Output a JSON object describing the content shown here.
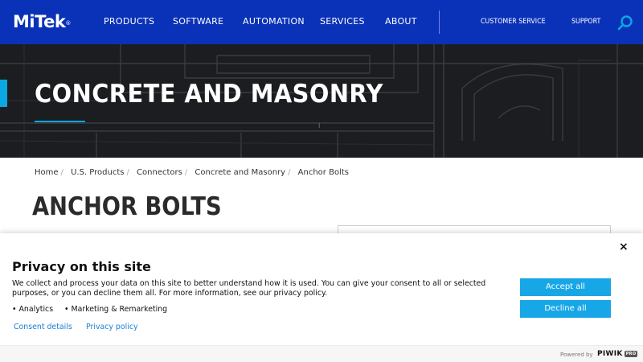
{
  "header": {
    "logo_text": "MiTek",
    "logo_mark": "®",
    "nav": [
      "PRODUCTS",
      "SOFTWARE",
      "AUTOMATION",
      "SERVICES",
      "ABOUT"
    ],
    "utility": [
      "CUSTOMER SERVICE",
      "SUPPORT"
    ],
    "search_icon": "search-icon",
    "bg_color": "#0a32b8"
  },
  "hero": {
    "title": "CONCRETE AND MASONRY",
    "accent_color": "#0aa7e3"
  },
  "breadcrumb": [
    "Home",
    "U.S. Products",
    "Connectors",
    "Concrete and Masonry",
    "Anchor Bolts"
  ],
  "breadcrumb_separator": "/",
  "page": {
    "title": "ANCHOR BOLTS"
  },
  "privacy": {
    "close_icon": "close-icon",
    "close_glyph": "×",
    "title": "Privacy on this site",
    "body": "We collect and process your data on this site to better understand how it is used. You can give your consent to all or selected purposes, or you can decline them all. For more information, see our privacy policy.",
    "purposes": [
      "• Analytics",
      "• Marketing & Remarketing"
    ],
    "links": [
      "Consent details",
      "Privacy policy"
    ],
    "accept_label": "Accept all",
    "decline_label": "Decline all",
    "button_color": "#18a7e6",
    "powered_by": "Powered by",
    "brand": "PIWIK",
    "brand_badge": "PRO"
  }
}
